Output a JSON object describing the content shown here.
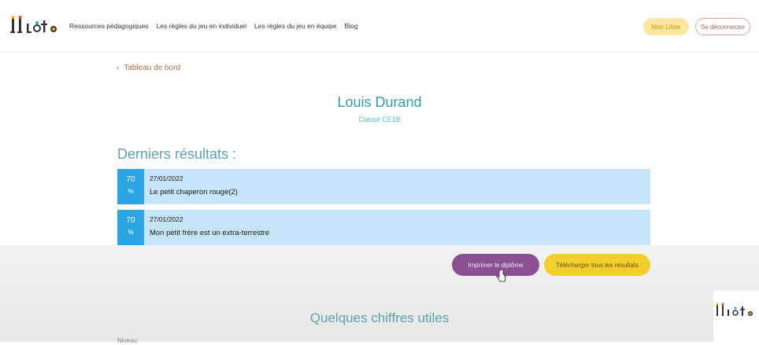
{
  "header": {
    "nav": [
      "Ressources pédagogiques",
      "Les règles du jeu en individuel",
      "Les règles du jeu en équipe",
      "Blog"
    ],
    "mon_lilote": "Mon Lilote",
    "logout": "Se déconnecter"
  },
  "back_link": "Tableau de bord",
  "student": {
    "name": "Louis Durand",
    "class": "Classe CE1B"
  },
  "results_title": "Derniers résultats :",
  "results": [
    {
      "score": "70",
      "unit": "%",
      "date": "27/01/2022",
      "title": "Le petit chaperon rouge(2)"
    },
    {
      "score": "70",
      "unit": "%",
      "date": "27/01/2022",
      "title": "Mon petit frère est un extra-terrestre"
    }
  ],
  "buttons": {
    "print": "Imprimer le diplôme",
    "download": "Télécharger tous les résultats"
  },
  "figures_title": "Quelques chiffres utiles",
  "level_label": "Niveau",
  "colors": {
    "teal": "#2f9ea3",
    "score_blue": "#2aa4e3",
    "row_bg": "#c7e5f8",
    "print_purple": "#8c4f94",
    "download_yellow": "#f2cf2c"
  }
}
